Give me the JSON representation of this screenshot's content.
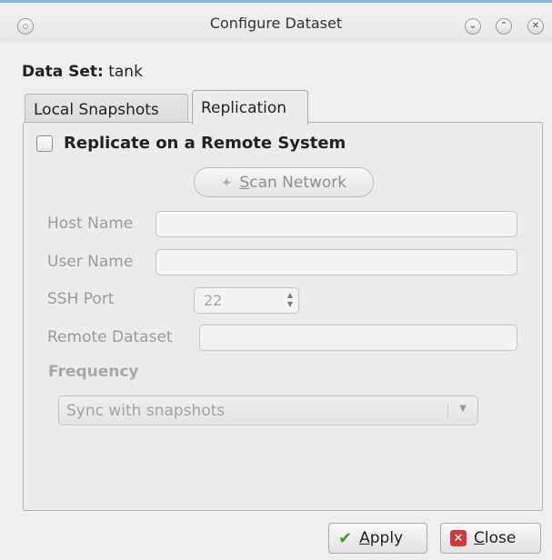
{
  "window": {
    "title": "Configure Dataset"
  },
  "dataset": {
    "label": "Data Set:",
    "value": "tank"
  },
  "tabs": [
    {
      "label": "Local Snapshots",
      "active": false
    },
    {
      "label": "Replication",
      "active": true
    }
  ],
  "replication": {
    "checkbox_label": "Replicate on a Remote System",
    "checked": false,
    "scan_button_label_underlined": "S",
    "scan_button_label_rest": "can Network",
    "host_name_label": "Host Name",
    "host_name_value": "",
    "user_name_label": "User Name",
    "user_name_value": "",
    "ssh_port_label": "SSH Port",
    "ssh_port_value": "22",
    "remote_dataset_label": "Remote Dataset",
    "remote_dataset_value": "",
    "frequency_label": "Frequency",
    "frequency_selected": "Sync with snapshots"
  },
  "buttons": {
    "apply_underlined": "A",
    "apply_rest": "pply",
    "close_underlined": "C",
    "close_rest": "lose"
  }
}
